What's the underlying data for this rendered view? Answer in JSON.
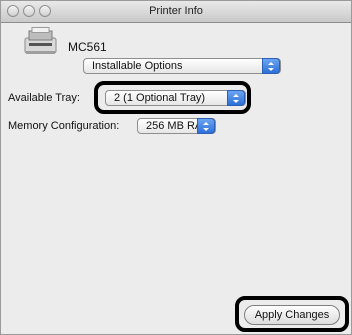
{
  "window": {
    "title": "Printer Info"
  },
  "printer": {
    "model": "MC561",
    "icon": "printer-icon"
  },
  "section_popup": {
    "value": "Installable Options"
  },
  "options": {
    "tray_label": "Available Tray:",
    "tray_value": "2 (1 Optional Tray)",
    "memory_label": "Memory Configuration:",
    "memory_value": "256 MB RAM"
  },
  "actions": {
    "apply_label": "Apply Changes"
  },
  "colors": {
    "callout": "#000000",
    "accent": "#2e6fd8"
  }
}
